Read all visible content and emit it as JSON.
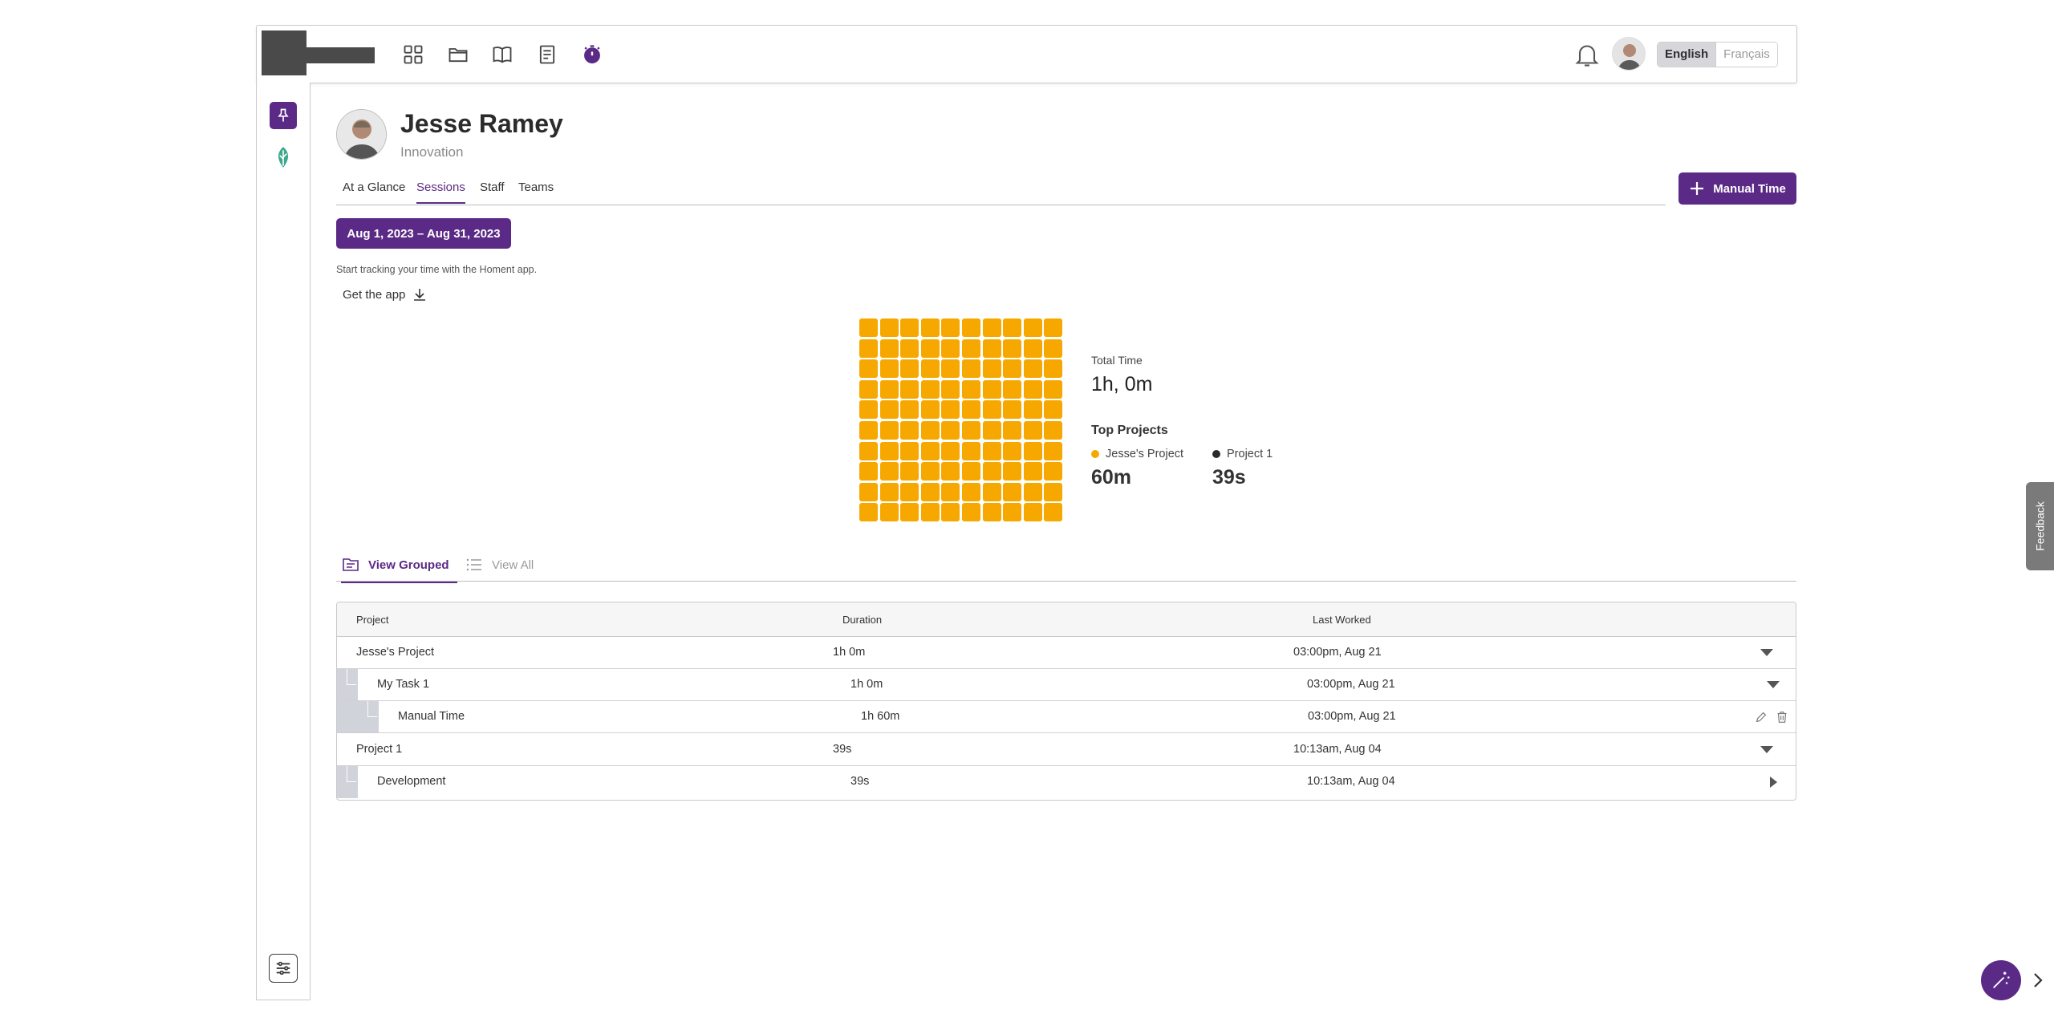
{
  "topbar": {
    "languages": {
      "active": "English",
      "inactive": "Français"
    },
    "nav_icons": [
      "dashboard-grid-icon",
      "folder-icon",
      "book-icon",
      "document-icon",
      "timer-icon"
    ]
  },
  "profile": {
    "name": "Jesse Ramey",
    "team": "Innovation"
  },
  "tabs": [
    {
      "label": "At a Glance"
    },
    {
      "label": "Sessions",
      "active": true
    },
    {
      "label": "Staff"
    },
    {
      "label": "Teams"
    }
  ],
  "actions": {
    "manual_time": "Manual Time",
    "date_range": "Aug 1, 2023 – Aug 31, 2023"
  },
  "tracking": {
    "note": "Start tracking your time with the Homent app.",
    "get_app": "Get the app"
  },
  "summary": {
    "total_label": "Total Time",
    "total_value": "1h, 0m",
    "top_projects_label": "Top Projects",
    "projects": [
      {
        "name": "Jesse's Project",
        "value": "60m",
        "color": "#f7a800"
      },
      {
        "name": "Project 1",
        "value": "39s",
        "color": "#2b2b2b"
      }
    ],
    "waffle_filled_cells": 100,
    "waffle_color": "#f7a800"
  },
  "view_tabs": {
    "grouped": "View Grouped",
    "all": "View All"
  },
  "table": {
    "headers": {
      "project": "Project",
      "duration": "Duration",
      "last_worked": "Last Worked"
    },
    "rows": [
      {
        "name": "Jesse's Project",
        "duration": "1h 0m",
        "last_worked": "03:00pm, Aug 21",
        "level": 0,
        "expanded": true
      },
      {
        "name": "My Task 1",
        "duration": "1h 0m",
        "last_worked": "03:00pm, Aug 21",
        "level": 1,
        "expanded": true
      },
      {
        "name": "Manual Time",
        "duration": "1h 60m",
        "last_worked": "03:00pm, Aug 21",
        "level": 2
      },
      {
        "name": "Project 1",
        "duration": "39s",
        "last_worked": "10:13am, Aug 04",
        "level": 0,
        "expanded": true
      },
      {
        "name": "Development",
        "duration": "39s",
        "last_worked": "10:13am, Aug 04",
        "level": 1,
        "expanded": false
      }
    ]
  },
  "feedback": "Feedback",
  "colors": {
    "accent": "#5b2a86",
    "waffle": "#f7a800"
  }
}
